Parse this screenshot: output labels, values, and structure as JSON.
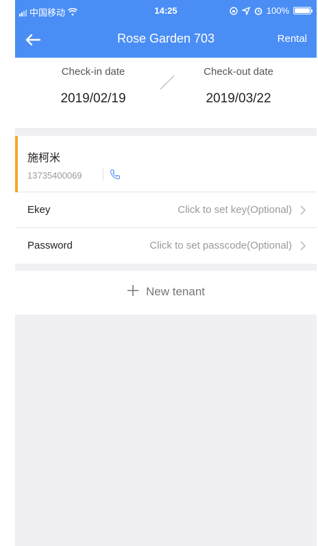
{
  "status_bar": {
    "carrier": "中国移动",
    "time": "14:25",
    "battery": "100%"
  },
  "nav": {
    "title": "Rose Garden 703",
    "right_label": "Rental"
  },
  "dates": {
    "checkin_label": "Check-in date",
    "checkin_value": "2019/02/19",
    "checkout_label": "Check-out date",
    "checkout_value": "2019/03/22"
  },
  "tenant": {
    "name": "施柯米",
    "phone": "13735400069"
  },
  "rows": [
    {
      "label": "Ekey",
      "value": "Click to set key(Optional)"
    },
    {
      "label": "Password",
      "value": "Click to set passcode(Optional)"
    }
  ],
  "new_tenant": {
    "label": "New tenant"
  },
  "colors": {
    "header_bg": "#4a8ef5",
    "accent": "#f5a623",
    "page_bg": "#efeff4"
  },
  "icons": [
    "back-arrow-icon",
    "phone-icon",
    "chevron-right-icon",
    "plus-icon",
    "wifi-icon",
    "location-icon",
    "alarm-icon"
  ]
}
